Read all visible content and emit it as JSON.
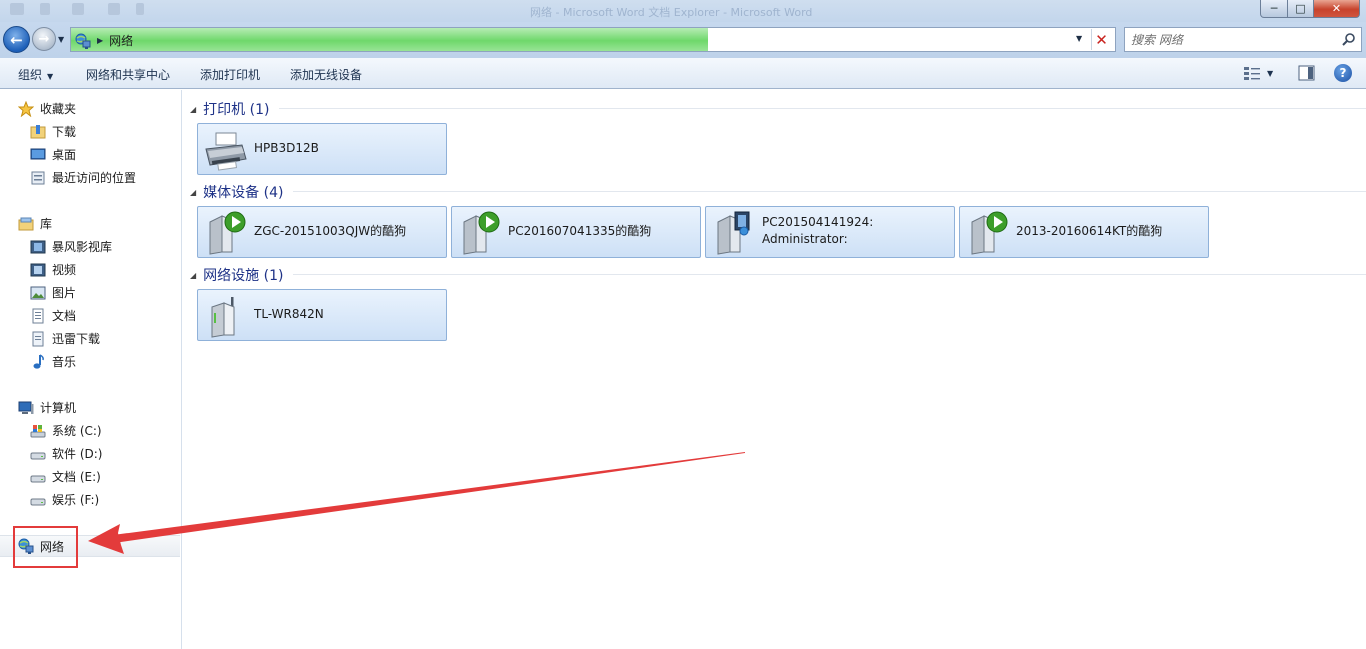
{
  "window": {
    "title": "网络 - Microsoft Word 文档 Explorer - Microsoft Word",
    "buttons": {
      "minimize": "─",
      "maximize": "□",
      "close": "✕"
    }
  },
  "address_bar": {
    "location_icon": "network-icon",
    "crumbs": [
      "网络"
    ],
    "loading_progress_pct": 61,
    "search_placeholder": "搜索 网络",
    "stop_icon": "✕"
  },
  "command_bar": {
    "organize": "组织",
    "network_sharing_center": "网络和共享中心",
    "add_printer": "添加打印机",
    "add_wireless_device": "添加无线设备",
    "help": "?"
  },
  "nav_pane": {
    "favorites": {
      "label": "收藏夹",
      "items": [
        {
          "label": "下载",
          "icon": "downloads-folder-icon"
        },
        {
          "label": "桌面",
          "icon": "desktop-icon"
        },
        {
          "label": "最近访问的位置",
          "icon": "recent-places-icon"
        }
      ]
    },
    "libraries": {
      "label": "库",
      "items": [
        {
          "label": "暴风影视库",
          "icon": "video-library-icon"
        },
        {
          "label": "视频",
          "icon": "videos-icon"
        },
        {
          "label": "图片",
          "icon": "pictures-icon"
        },
        {
          "label": "文档",
          "icon": "documents-icon"
        },
        {
          "label": "迅雷下载",
          "icon": "thunder-downloads-icon"
        },
        {
          "label": "音乐",
          "icon": "music-icon"
        }
      ]
    },
    "computer": {
      "label": "计算机",
      "items": [
        {
          "label": "系统 (C:)",
          "icon": "system-drive-icon"
        },
        {
          "label": "软件 (D:)",
          "icon": "drive-icon"
        },
        {
          "label": "文档 (E:)",
          "icon": "drive-icon"
        },
        {
          "label": "娱乐 (F:)",
          "icon": "drive-icon"
        }
      ]
    },
    "network": {
      "label": "网络",
      "icon": "network-icon"
    }
  },
  "content": {
    "groups": [
      {
        "header": "打印机 (1)",
        "items": [
          {
            "name": "HPB3D12B",
            "icon": "printer-icon"
          }
        ]
      },
      {
        "header": "媒体设备 (4)",
        "items": [
          {
            "name": "ZGC-20151003QJW的酷狗",
            "icon": "media-server-icon"
          },
          {
            "name": "PC201607041335的酷狗",
            "icon": "media-server-icon"
          },
          {
            "name": "PC201504141924:",
            "name2": "Administrator:",
            "icon": "media-player-icon"
          },
          {
            "name": "2013-20160614KT的酷狗",
            "icon": "media-server-icon"
          }
        ]
      },
      {
        "header": "网络设施 (1)",
        "items": [
          {
            "name": "TL-WR842N",
            "icon": "router-icon"
          }
        ]
      }
    ]
  },
  "annotation": {
    "arrow_color": "#e33b3b",
    "box_color": "#e33b3b"
  }
}
